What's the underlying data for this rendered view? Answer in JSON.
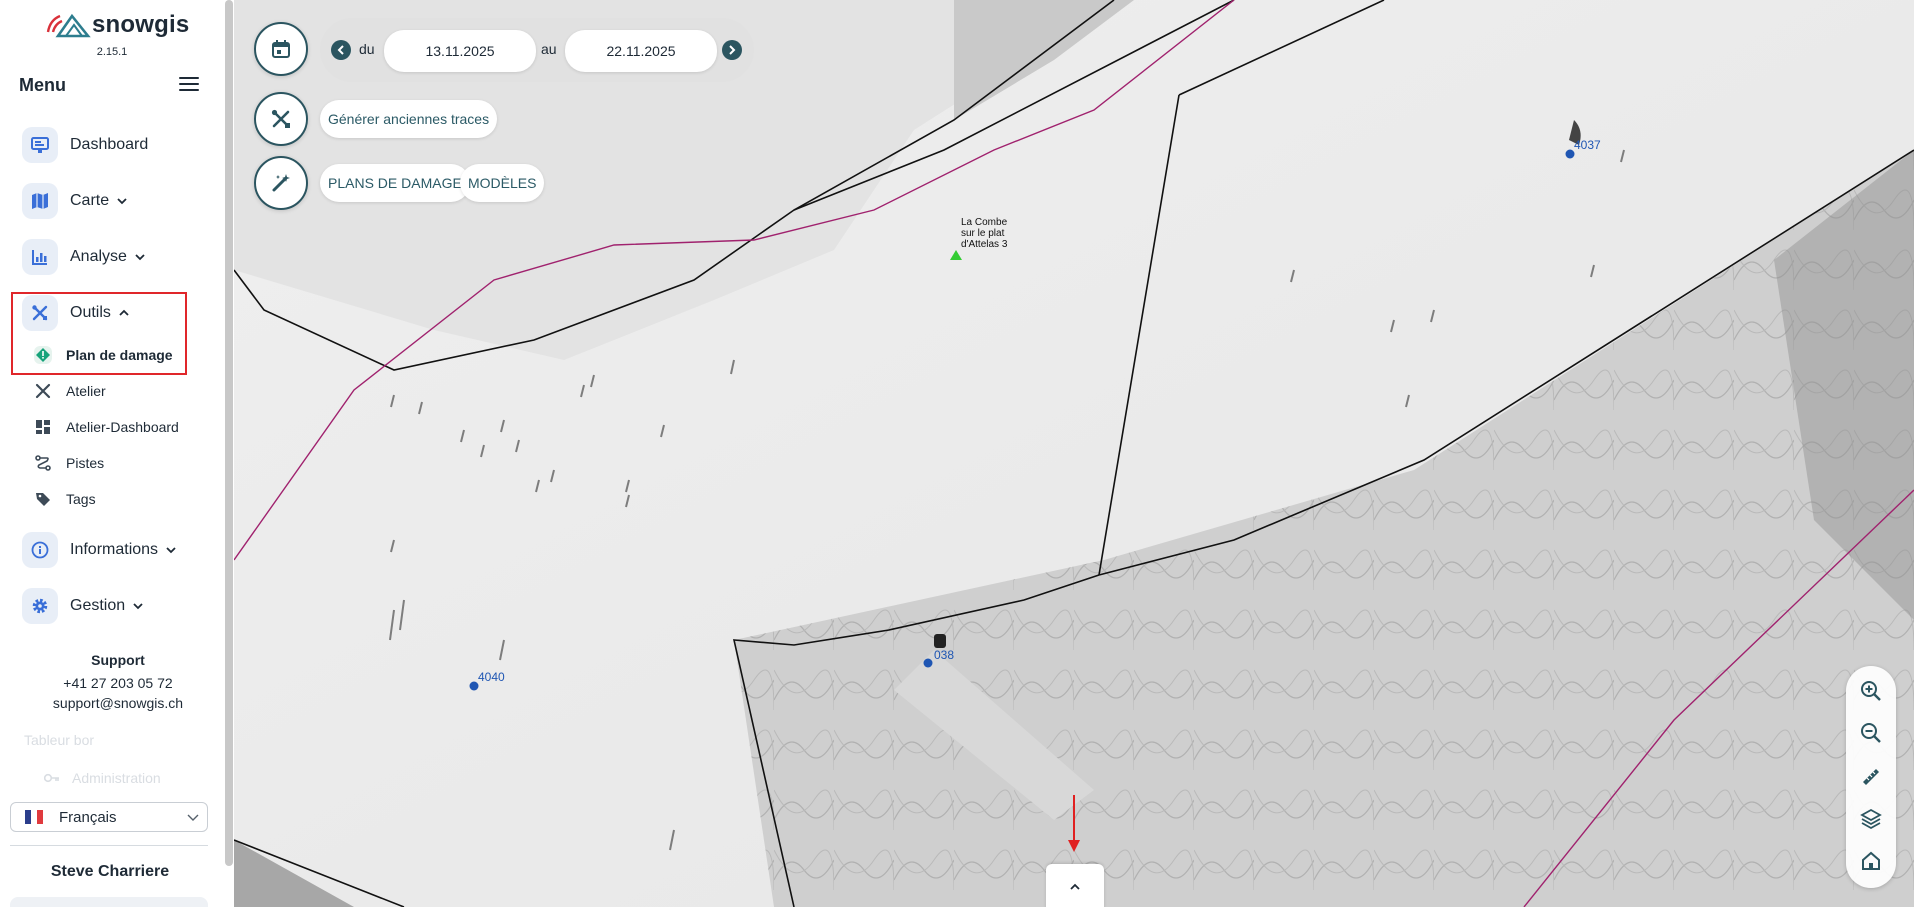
{
  "app": {
    "brand": "snowgis",
    "version": "2.15.1"
  },
  "sidebar": {
    "menu_title": "Menu",
    "items": [
      {
        "label": "Dashboard",
        "icon": "monitor-icon"
      },
      {
        "label": "Carte",
        "icon": "map-icon"
      },
      {
        "label": "Analyse",
        "icon": "bar-chart-icon"
      },
      {
        "label": "Outils",
        "icon": "tools-icon"
      },
      {
        "label": "Informations",
        "icon": "info-icon"
      },
      {
        "label": "Gestion",
        "icon": "gear-icon"
      }
    ],
    "outils_sub": [
      {
        "label": "Plan de damage",
        "icon": "diamond-marker-icon",
        "active": true
      },
      {
        "label": "Atelier",
        "icon": "tools-icon"
      },
      {
        "label": "Atelier-Dashboard",
        "icon": "dashboard-icon"
      },
      {
        "label": "Pistes",
        "icon": "route-icon"
      },
      {
        "label": "Tags",
        "icon": "tags-icon"
      }
    ],
    "support": {
      "title": "Support",
      "phone": "+41 27 203 05 72",
      "email": "support@snowgis.ch"
    },
    "faded_items": [
      "Tableur bor",
      "Administration"
    ],
    "language": "Français",
    "user_name": "Steve Charriere"
  },
  "map": {
    "date_from_label": "du",
    "date_from": "13.11.2025",
    "date_to_label": "au",
    "date_to": "22.11.2025",
    "generate_button": "Générer anciennes traces",
    "plans_button": "PLANS DE DAMAGE",
    "models_button": "MODÈLES",
    "place_label": [
      "La Combe",
      "sur le plat",
      "d'Attelas 3"
    ],
    "markers": [
      "4037",
      "038",
      "4040"
    ],
    "zoom_controls": [
      "zoom-in-icon",
      "zoom-out-icon",
      "ruler-icon",
      "layers-icon",
      "home-icon"
    ],
    "accent_color": "#2b5560"
  }
}
